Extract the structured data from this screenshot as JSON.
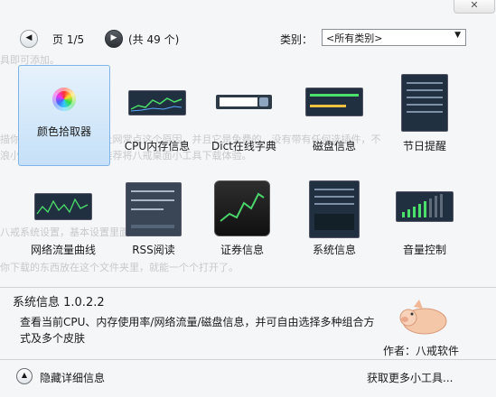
{
  "window": {
    "close_glyph": "✕"
  },
  "pager": {
    "page_label": "页 1/5",
    "count_label": "(共 49 个)",
    "prev_glyph": "◀",
    "next_glyph": "▶"
  },
  "filter": {
    "label": "类别：",
    "value": "<所有类别>",
    "arrow": "▼"
  },
  "gadgets": [
    {
      "label": "颜色拾取器",
      "icon": "color-wheel-icon"
    },
    {
      "label": "CPU内存信息",
      "icon": "cpu-meter-icon"
    },
    {
      "label": "Dict在线字典",
      "icon": "search-box-icon"
    },
    {
      "label": "磁盘信息",
      "icon": "disk-meter-icon"
    },
    {
      "label": "节日提醒",
      "icon": "calendar-list-icon"
    },
    {
      "label": "网络流量曲线",
      "icon": "network-graph-icon"
    },
    {
      "label": "RSS阅读",
      "icon": "rss-reader-icon"
    },
    {
      "label": "证券信息",
      "icon": "stock-chart-icon"
    },
    {
      "label": "系统信息",
      "icon": "system-info-icon"
    },
    {
      "label": "音量控制",
      "icon": "volume-bars-icon"
    }
  ],
  "details": {
    "title": "系统信息 1.0.2.2",
    "description": "查看当前CPU、内存使用率/网络流量/磁盘信息，并可自由选择多种组合方式及多个皮肤",
    "author": "作者：八戒软件"
  },
  "footer": {
    "collapse_label": "隐藏详细信息",
    "more_link": "获取更多小工具...",
    "collapse_glyph": "▲"
  },
  "colors": {
    "selection": "#c5e0f8",
    "accent_green": "#49d46b"
  }
}
